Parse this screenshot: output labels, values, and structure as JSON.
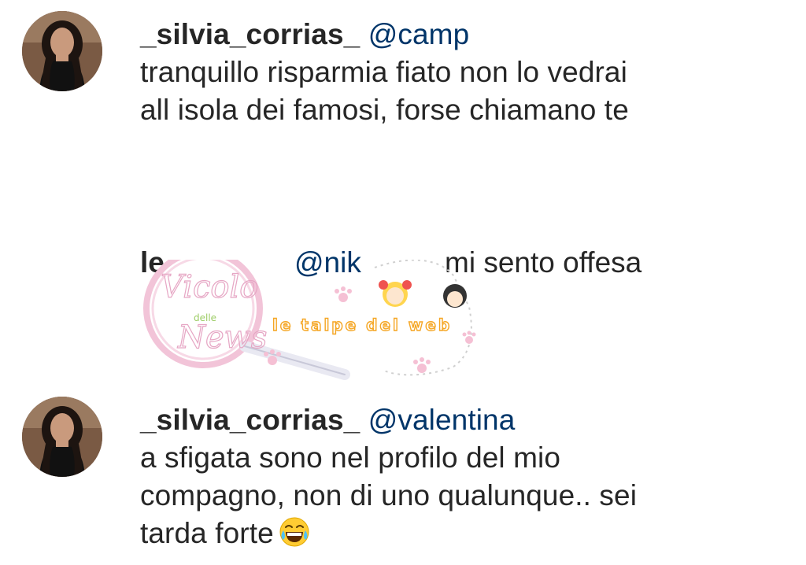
{
  "comments": [
    {
      "username": "_silvia_corrias_",
      "mention": "@camp",
      "lines": [
        "tranquillo risparmia fiato non lo vedrai",
        "all isola dei famosi, forse chiamano te"
      ],
      "avatar_icon": "user-avatar-photo"
    },
    {
      "username": "_silvia_corrias_",
      "mention": "@valentina",
      "lines": [
        "a sfigata sono nel profilo del mio",
        "compagno, non di uno qualunque.. sei",
        "tarda forte"
      ],
      "emoji_icon": "tears-of-joy-emoji",
      "avatar_icon": "user-avatar-photo"
    }
  ],
  "reply": {
    "prefix": "le",
    "mention": "@nik",
    "text": "mi sento offesa"
  },
  "watermark": {
    "brand_top": "Vicolo",
    "brand_small": "delle",
    "brand_bottom": "News",
    "tagline": "le talpe del web"
  },
  "colors": {
    "text": "#262626",
    "mention": "#003569",
    "watermark_pink": "#e8a0c0",
    "watermark_green": "#8bc34a",
    "watermark_orange": "#f5a623"
  }
}
